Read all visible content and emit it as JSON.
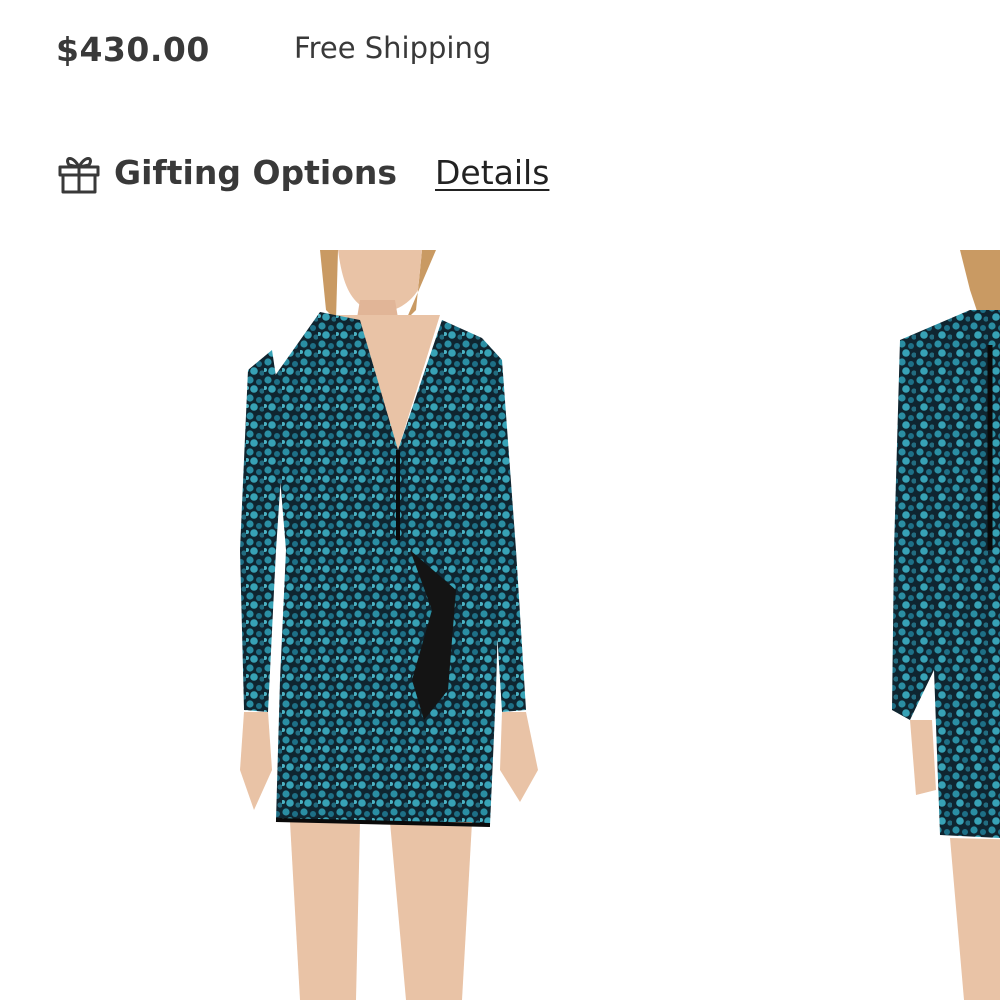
{
  "product": {
    "price": "$430.00",
    "shipping": "Free Shipping"
  },
  "gifting": {
    "icon": "gift-icon",
    "label": "Gifting Options",
    "details_link": "Details"
  },
  "gallery": {
    "images": [
      {
        "name": "dress-front-image",
        "alt": ""
      },
      {
        "name": "dress-back-image",
        "alt": ""
      }
    ]
  },
  "colors": {
    "text": "#393939",
    "sequin_teal": "#1f7f95",
    "sequin_dark": "#0c1f2a",
    "skin": "#e9c3a6",
    "hair": "#c99a63"
  }
}
